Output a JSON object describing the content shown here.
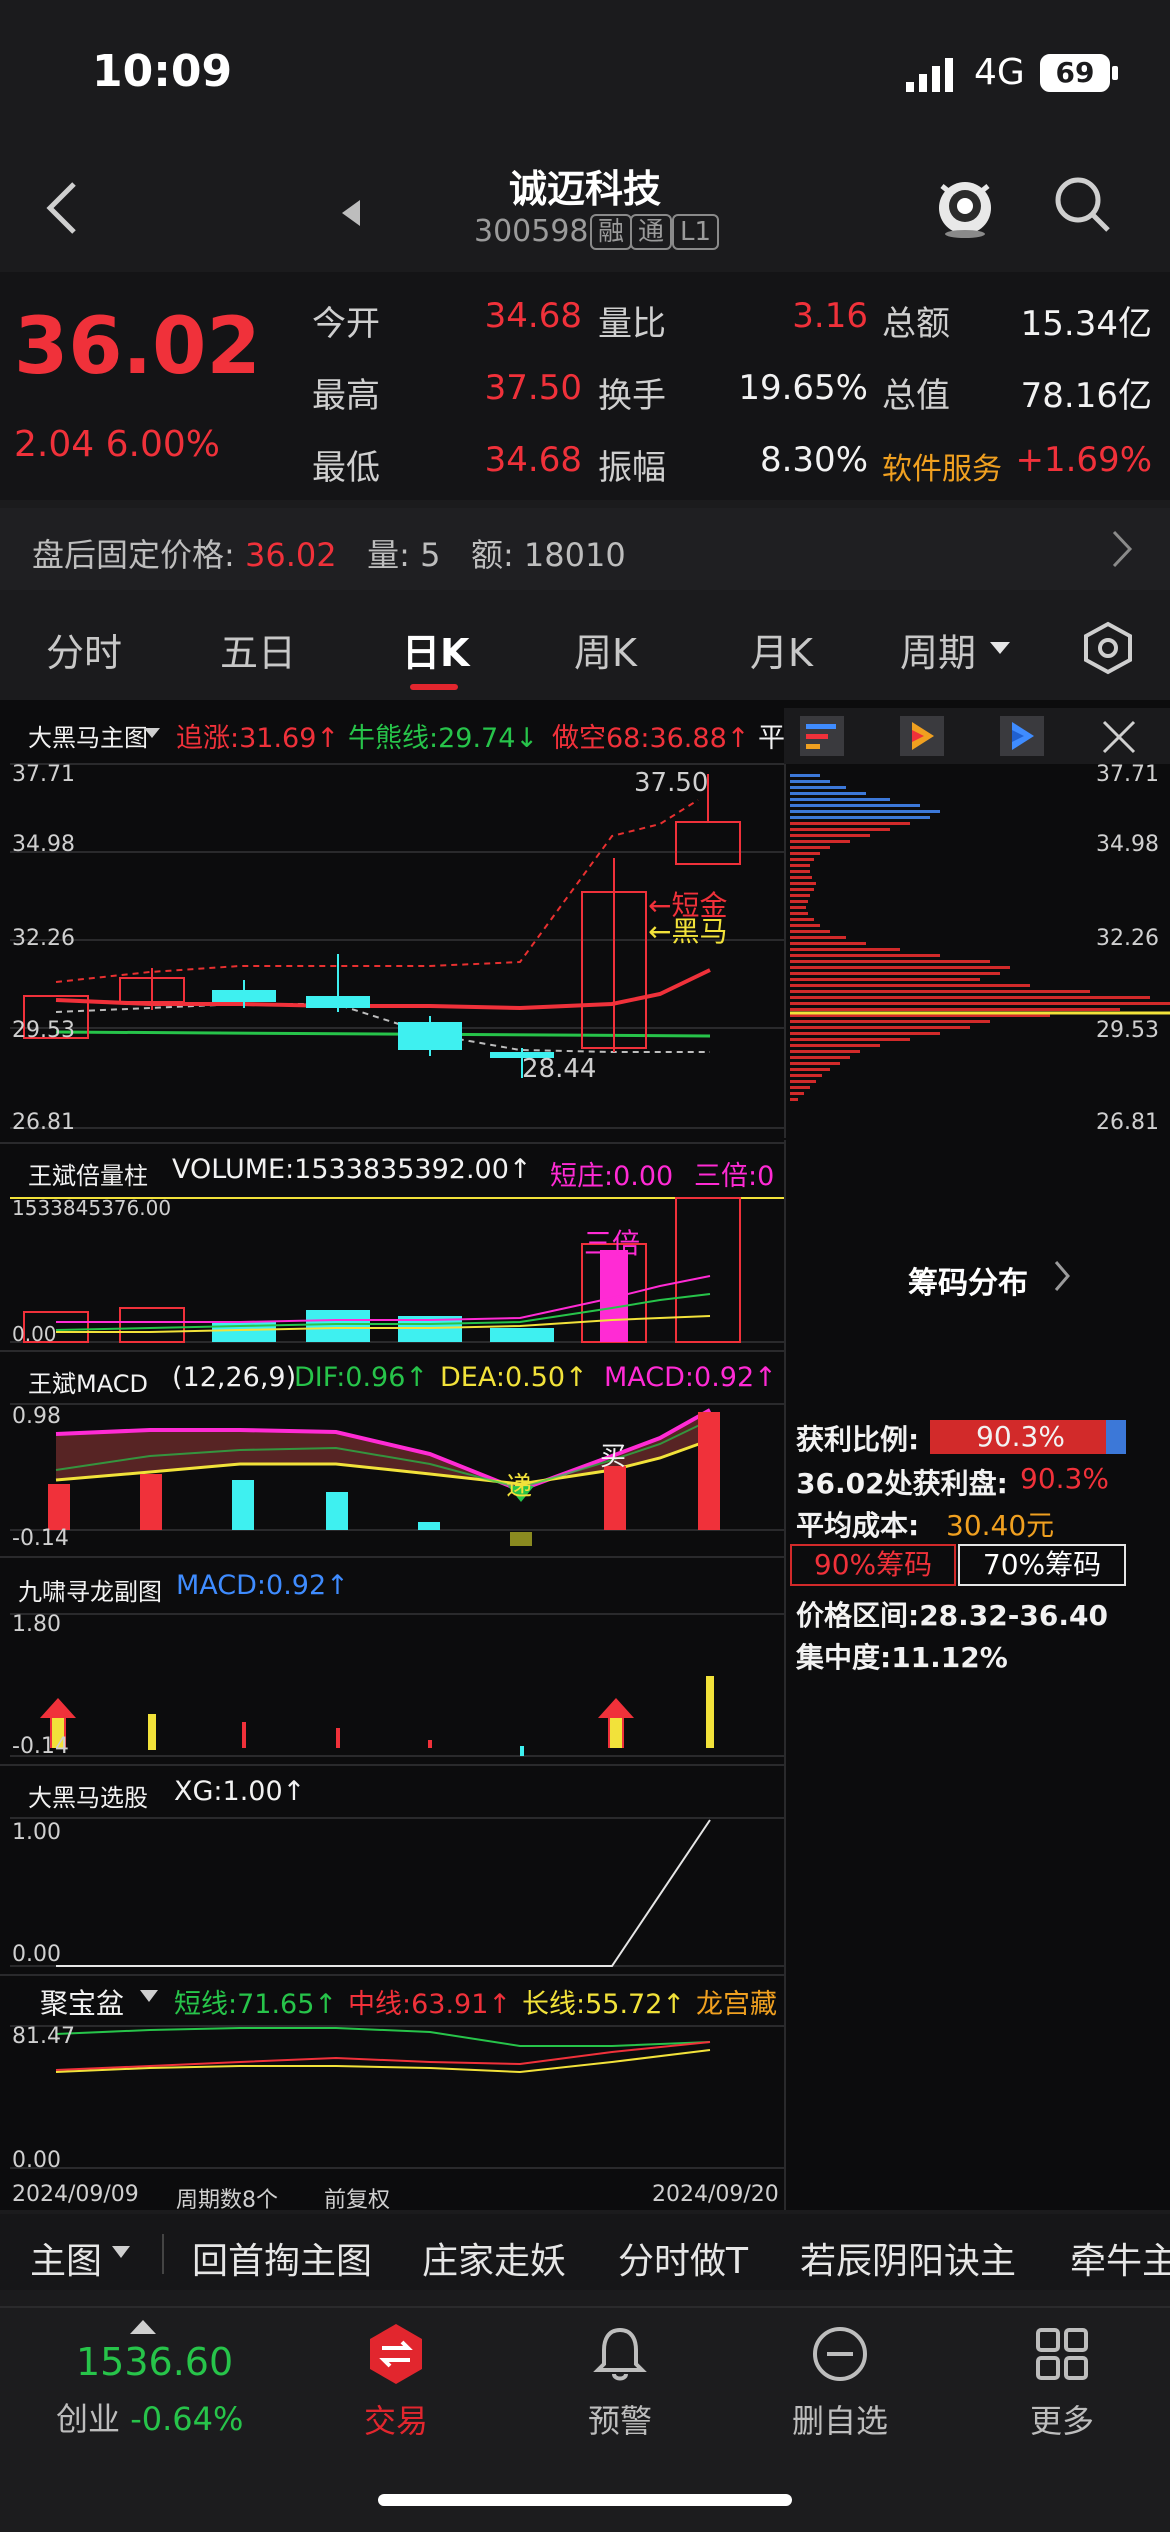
{
  "status": {
    "time": "10:09",
    "network": "4G",
    "battery": "69"
  },
  "header": {
    "name": "诚迈科技",
    "code": "300598",
    "tags": [
      "融",
      "通",
      "L1"
    ]
  },
  "quote": {
    "price": "36.02",
    "change": "2.04",
    "change_pct": "6.00%",
    "rows": [
      [
        {
          "l": "今开",
          "v": "34.68",
          "c": "red"
        },
        {
          "l": "量比",
          "v": "3.16",
          "c": "red"
        },
        {
          "l": "总额",
          "v": "15.34亿",
          "c": "white"
        }
      ],
      [
        {
          "l": "最高",
          "v": "37.50",
          "c": "red"
        },
        {
          "l": "换手",
          "v": "19.65%",
          "c": "white"
        },
        {
          "l": "总值",
          "v": "78.16亿",
          "c": "white"
        }
      ],
      [
        {
          "l": "最低",
          "v": "34.68",
          "c": "red"
        },
        {
          "l": "振幅",
          "v": "8.30%",
          "c": "white"
        },
        {
          "l": "软件服务",
          "v": "+1.69%",
          "c": "red"
        }
      ]
    ]
  },
  "afterhours": {
    "label": "盘后固定价格:",
    "price": "36.02",
    "vol_label": "量:",
    "vol": "5",
    "amt_label": "额:",
    "amt": "18010"
  },
  "tabs": [
    "分时",
    "五日",
    "日K",
    "周K",
    "月K",
    "周期"
  ],
  "main_chart": {
    "title": "大黑马主图",
    "ind1": "追涨:31.69↑",
    "ind2": "牛熊线:29.74↓",
    "ind3": "做空68:36.88↑",
    "ind4": "平",
    "yticks": [
      "37.71",
      "34.98",
      "32.26",
      "29.53",
      "26.81"
    ],
    "high_label": "37.50",
    "low_label": "28.44",
    "ann1": "←短金",
    "ann2": "←黑马"
  },
  "chip": {
    "yticks": [
      "37.71",
      "34.98",
      "32.26",
      "29.53",
      "26.81"
    ],
    "title": "筹码分布",
    "profit_ratio_label": "获利比例:",
    "profit_ratio": "90.3%",
    "profit_at_label": "36.02处获利盘:",
    "profit_at": "90.3%",
    "avg_cost_label": "平均成本:",
    "avg_cost": "30.40元",
    "btn90": "90%筹码",
    "btn70": "70%筹码",
    "range_label": "价格区间:",
    "range": "28.32-36.40",
    "conc_label": "集中度:",
    "conc": "11.12%"
  },
  "volume": {
    "title": "王斌倍量柱",
    "v1": "VOLUME:1533835392.00↑",
    "v2": "短庄:0.00",
    "v3": "三倍:0",
    "ytop": "1533845376.00",
    "ybot": "0.00",
    "ann": "三倍"
  },
  "macd": {
    "title": "王斌MACD",
    "params": "(12,26,9)",
    "dif": "DIF:0.96↑",
    "dea": "DEA:0.50↑",
    "macd": "MACD:0.92↑",
    "ytop": "0.98",
    "ybot": "-0.14",
    "ann_buy": "买",
    "ann_hl": "递"
  },
  "jiuxiao": {
    "title": "九啸寻龙副图",
    "macd": "MACD:0.92↑",
    "ytop": "1.80",
    "ybot": "-0.14"
  },
  "xg": {
    "title": "大黑马选股",
    "xg": "XG:1.00↑",
    "ytop": "1.00",
    "ybot": "0.00"
  },
  "jbp": {
    "title": "聚宝盆",
    "s": "短线:71.65↑",
    "m": "中线:63.91↑",
    "l": "长线:55.72↑",
    "x": "龙宫藏",
    "ytop": "81.47",
    "ybot": "0.00"
  },
  "footer": {
    "start": "2024/09/09",
    "count": "周期数8个",
    "adj": "前复权",
    "end": "2024/09/20"
  },
  "strip": [
    "主图",
    "回首掏主图",
    "庄家走妖",
    "分时做T",
    "若辰阴阳诀主",
    "牵牛主"
  ],
  "nav": {
    "index_val": "1536.60",
    "index_name": "创业",
    "index_chg": "-0.64%",
    "items": [
      "交易",
      "预警",
      "删自选",
      "更多"
    ]
  },
  "colors": {
    "up": "#f0313a",
    "down": "#27c44a",
    "cyan": "#3ef0f0",
    "yellow": "#f2e23a",
    "magenta": "#ff2bd4"
  }
}
